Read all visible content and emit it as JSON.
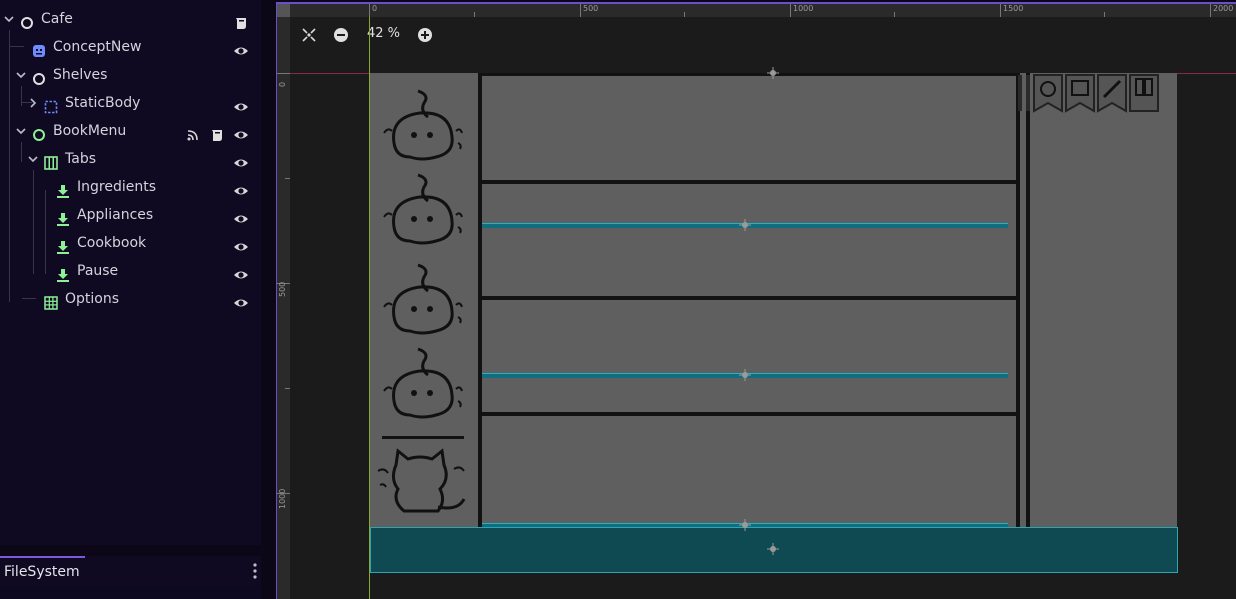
{
  "scene_tree": {
    "nodes": [
      {
        "name": "Cafe",
        "icon": "node-icon",
        "color": "#e0e0e0"
      },
      {
        "name": "ConceptNew",
        "icon": "sprite-icon",
        "color": "#6f8cff"
      },
      {
        "name": "Shelves",
        "icon": "node-icon",
        "color": "#e0e0e0"
      },
      {
        "name": "StaticBody",
        "icon": "collision-body-icon",
        "color": "#6f8cff"
      },
      {
        "name": "BookMenu",
        "icon": "control-node-icon",
        "color": "#8eef97"
      },
      {
        "name": "Tabs",
        "icon": "tab-container-icon",
        "color": "#8eef97"
      },
      {
        "name": "Ingredients",
        "icon": "instance-icon",
        "color": "#8eef97"
      },
      {
        "name": "Appliances",
        "icon": "instance-icon",
        "color": "#8eef97"
      },
      {
        "name": "Cookbook",
        "icon": "instance-icon",
        "color": "#8eef97"
      },
      {
        "name": "Pause",
        "icon": "instance-icon",
        "color": "#8eef97"
      },
      {
        "name": "Options",
        "icon": "grid-container-icon",
        "color": "#8eef97"
      }
    ]
  },
  "filesystem": {
    "tab_label": "FileSystem"
  },
  "viewport": {
    "zoom_label": "42 %",
    "ruler_h": [
      "0",
      "500",
      "1000",
      "1500",
      "2000"
    ],
    "ruler_v": [
      "0",
      "500",
      "1000"
    ]
  },
  "colors": {
    "accent": "#6a4fc8",
    "node_green": "#8eef97",
    "node_blue": "#6f8cff",
    "teal_panel": "#0f4a52"
  }
}
